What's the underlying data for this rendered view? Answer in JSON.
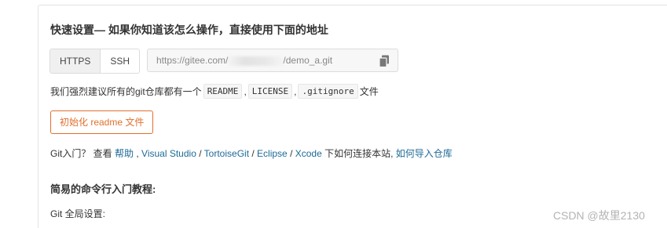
{
  "section": {
    "title": "快速设置— 如果你知道该怎么操作，直接使用下面的地址"
  },
  "protocol": {
    "https_label": "HTTPS",
    "ssh_label": "SSH",
    "selected": "HTTPS"
  },
  "repo_url": {
    "prefix": "https://gitee.com/",
    "suffix": "/demo_a.git",
    "copy_icon": "copy-icon"
  },
  "hint": {
    "text_before": "我们强烈建议所有的git仓库都有一个",
    "file1": "README",
    "sep1": ",",
    "file2": "LICENSE",
    "sep2": ",",
    "file3": ".gitignore",
    "text_after": "文件"
  },
  "init_button": {
    "label": "初始化 readme 文件"
  },
  "guide": {
    "prefix": "Git入门？ 查看 ",
    "help": "帮助",
    "sep0": " , ",
    "visual_studio": "Visual Studio",
    "sep1": " / ",
    "tortoisegit": "TortoiseGit",
    "sep2": " / ",
    "eclipse": "Eclipse",
    "sep3": " / ",
    "xcode": "Xcode",
    "middle": " 下如何连接本站, ",
    "import_repo": "如何导入仓库"
  },
  "commands": {
    "title": "简易的命令行入门教程:",
    "global_setup_label": "Git 全局设置:"
  },
  "watermark": "CSDN @故里2130",
  "colors": {
    "accent_orange": "#e1702d",
    "link_blue": "#1d6a96"
  }
}
